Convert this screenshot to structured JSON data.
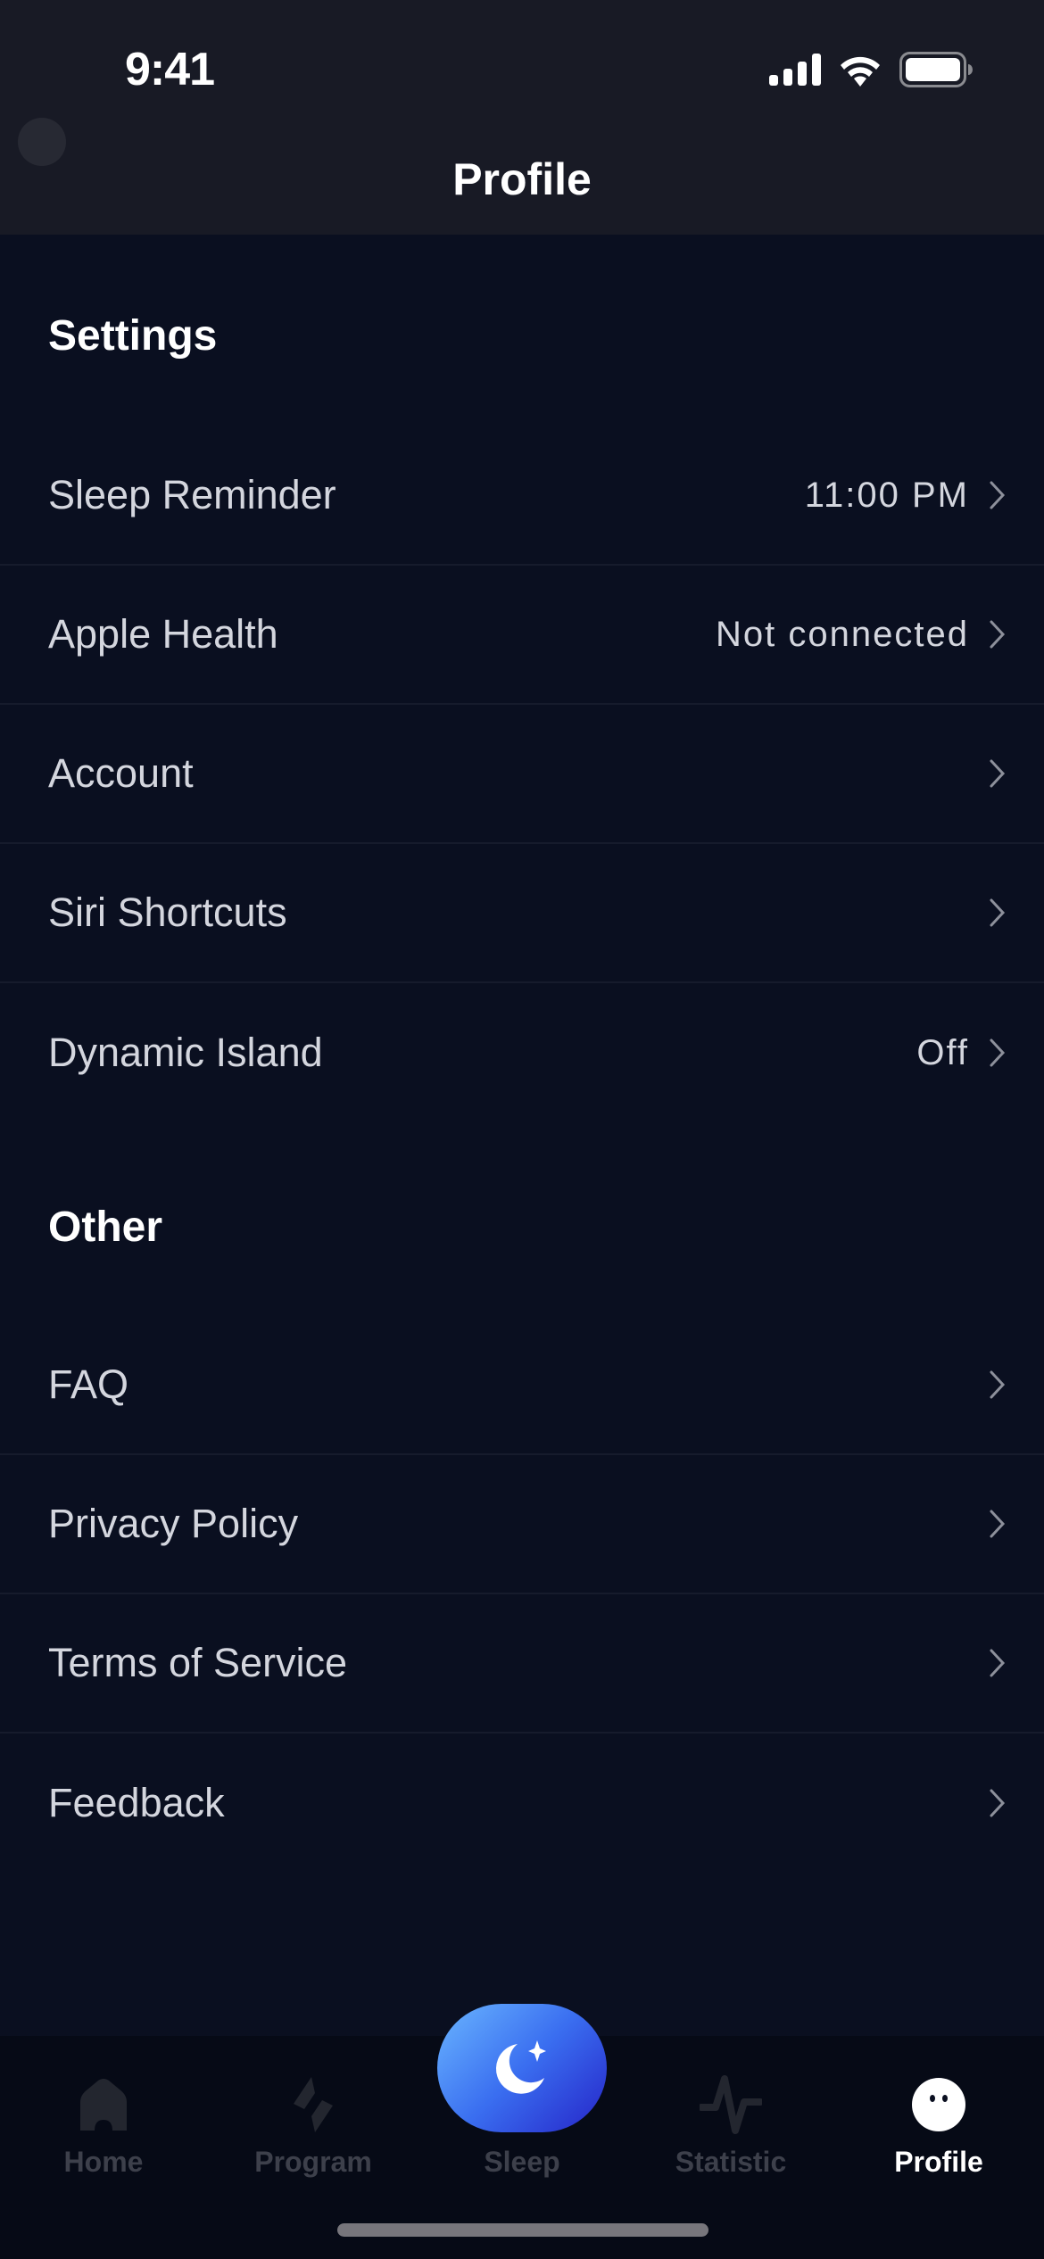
{
  "status_bar": {
    "time": "9:41"
  },
  "header": {
    "title": "Profile"
  },
  "sections": [
    {
      "title": "Settings",
      "items": [
        {
          "label": "Sleep Reminder",
          "value": "11:00 PM"
        },
        {
          "label": "Apple Health",
          "value": "Not connected"
        },
        {
          "label": "Account",
          "value": ""
        },
        {
          "label": "Siri Shortcuts",
          "value": ""
        },
        {
          "label": "Dynamic Island",
          "value": "Off"
        }
      ]
    },
    {
      "title": "Other",
      "items": [
        {
          "label": "FAQ",
          "value": ""
        },
        {
          "label": "Privacy Policy",
          "value": ""
        },
        {
          "label": "Terms of Service",
          "value": ""
        },
        {
          "label": "Feedback",
          "value": ""
        }
      ]
    }
  ],
  "tabbar": {
    "tabs": [
      {
        "label": "Home",
        "icon": "home-icon",
        "active": false
      },
      {
        "label": "Program",
        "icon": "program-icon",
        "active": false
      },
      {
        "label": "Sleep",
        "icon": "moon-icon",
        "active": false
      },
      {
        "label": "Statistic",
        "icon": "pulse-icon",
        "active": false
      },
      {
        "label": "Profile",
        "icon": "ghost-face-icon",
        "active": true
      }
    ]
  },
  "colors": {
    "background": "#0a0f20",
    "header": "#181a25",
    "accent_gradient_start": "#6ab6ff",
    "accent_gradient_end": "#2524c8"
  }
}
